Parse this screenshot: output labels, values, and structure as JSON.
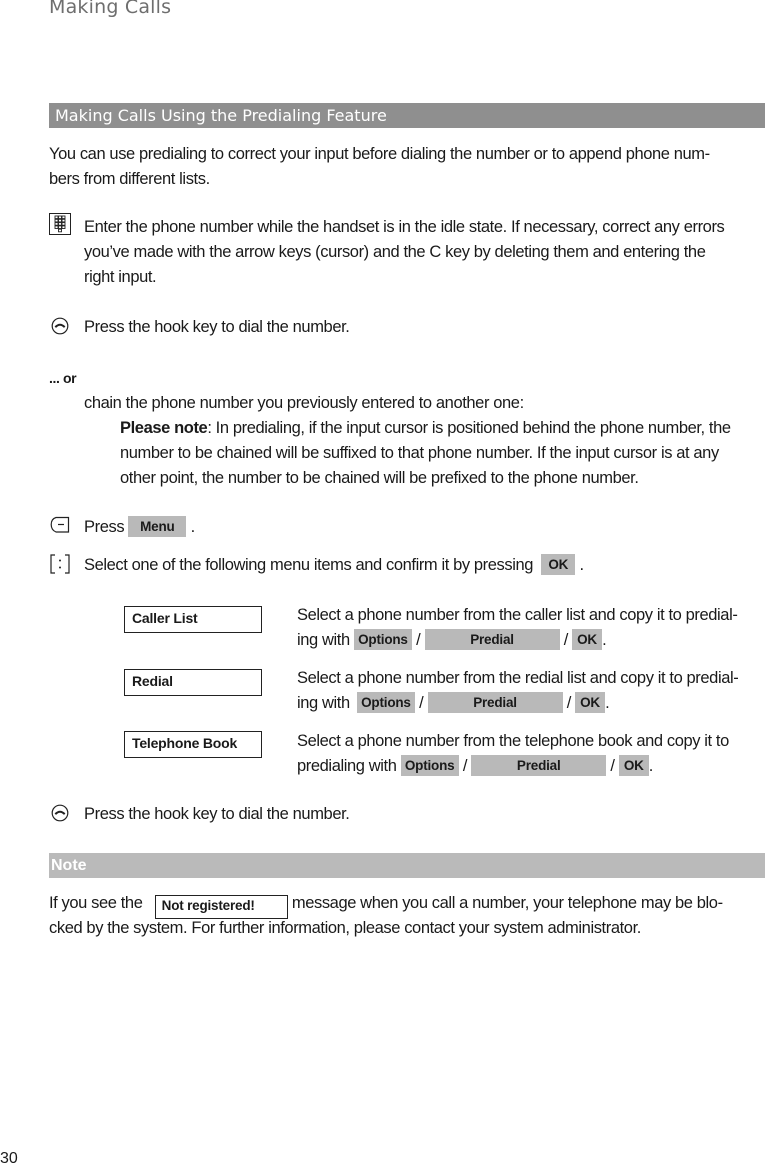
{
  "header": {
    "title": "Making Calls"
  },
  "section": {
    "title": "Making Calls Using the Predialing Feature",
    "intro_line1": "You can use predialing to correct your input before dialing the number or to append phone num-",
    "intro_line2": "bers from different lists."
  },
  "steps": {
    "enter_number": {
      "icon": "keypad-icon",
      "line1": "Enter the phone number while the handset is in the idle state. If necessary, correct any errors",
      "line2": "you’ve made with the arrow keys (cursor) and the C key by deleting them and entering the",
      "line3": "right input."
    },
    "hook_key_1": {
      "icon": "hook-key-icon",
      "text": "Press the hook key to dial the number."
    },
    "or_label": "... or",
    "chain": {
      "text": "chain the phone number you previously entered to another one:",
      "note_label": "Please note",
      "note_line1": ": In predialing, if the input cursor is positioned behind the phone number, the",
      "note_line2": "number to be chained will be suffixed to that phone number. If the input cursor is at any",
      "note_line3": "other point, the number to be chained will be prefixed to the phone number."
    },
    "press_menu": {
      "icon": "softkey-icon",
      "prefix": "Press",
      "key": "Menu",
      "suffix": "."
    },
    "select_item": {
      "icon": "navigation-key-icon",
      "text": "Select one of the following menu items and confirm it by pressing",
      "key": "OK",
      "suffix": "."
    },
    "hook_key_2": {
      "icon": "hook-key-icon",
      "text": "Press the hook key to dial the number."
    }
  },
  "menu_items": [
    {
      "label": "Caller List",
      "line1": "Select a phone number from the caller list and copy it to predial-",
      "line2_prefix": "ing with",
      "keys": [
        "Options",
        "Predial",
        "OK"
      ]
    },
    {
      "label": "Redial",
      "line1": "Select a phone number from the redial list and copy it to predial-",
      "line2_prefix": "ing with",
      "keys": [
        "Options",
        "Predial",
        "OK"
      ]
    },
    {
      "label": "Telephone Book",
      "line1": "Select a phone number from the telephone book and copy it to",
      "line2_prefix": "predialing with",
      "keys": [
        "Options",
        "Predial",
        "OK"
      ]
    }
  ],
  "separator": "/",
  "period": ".",
  "note": {
    "title": "Note",
    "prefix": "If you see the",
    "display_message": "Not registered!",
    "line1_suffix": "message when you call a number, your telephone may be blo-",
    "line2": "cked by the system. For further information, please contact your system administrator."
  },
  "page_number": "30",
  "colors": {
    "section_bar": "#8f8f8f",
    "note_bar": "#bababa",
    "softkey_fill": "#b9b9b9",
    "header_text": "#6e6e6e"
  }
}
